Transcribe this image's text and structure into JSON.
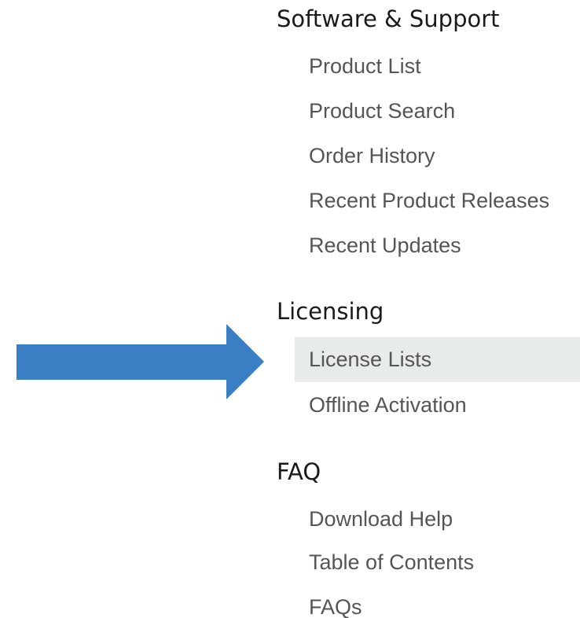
{
  "sections": [
    {
      "title": "Software & Support",
      "items": [
        {
          "label": "Product List"
        },
        {
          "label": "Product Search"
        },
        {
          "label": "Order History"
        },
        {
          "label": "Recent Product Releases"
        },
        {
          "label": "Recent Updates"
        }
      ]
    },
    {
      "title": "Licensing",
      "items": [
        {
          "label": "License Lists",
          "active": true
        },
        {
          "label": "Offline Activation"
        }
      ]
    },
    {
      "title": "FAQ",
      "items": [
        {
          "label": "Download Help"
        },
        {
          "label": "Table of Contents"
        },
        {
          "label": "FAQs"
        }
      ]
    }
  ],
  "pointer_arrow": {
    "color": "#3a7fc4",
    "points_to": "License Lists"
  },
  "colors": {
    "active_item_background": "#e8ebeb",
    "item_text": "#555555",
    "section_title_text": "#1a1a1a"
  }
}
